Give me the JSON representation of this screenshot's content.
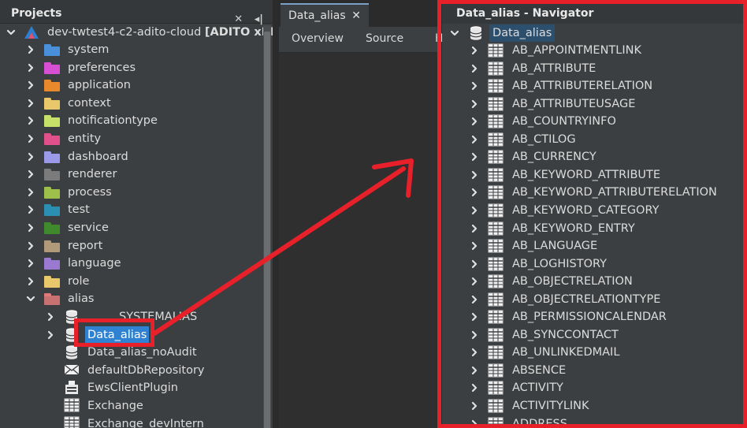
{
  "projects": {
    "title": "Projects",
    "close_glyph": "✕",
    "minimize_glyph": "◂|",
    "root_label": "dev-twtest4-c2-adito-cloud",
    "root_suffix": "[ADITO xRM]",
    "folders": [
      {
        "label": "system",
        "color": "#4a8fd9"
      },
      {
        "label": "preferences",
        "color": "#d94fd3"
      },
      {
        "label": "application",
        "color": "#e88a2c"
      },
      {
        "label": "context",
        "color": "#e8c86a"
      },
      {
        "label": "notificationtype",
        "color": "#c6e06a"
      },
      {
        "label": "entity",
        "color": "#e0508a"
      },
      {
        "label": "dashboard",
        "color": "#9a9ae8"
      },
      {
        "label": "renderer",
        "color": "#7b7b7b"
      },
      {
        "label": "process",
        "color": "#9dc04a"
      },
      {
        "label": "test",
        "color": "#2a8fb0"
      },
      {
        "label": "service",
        "color": "#3f8a2c"
      },
      {
        "label": "report",
        "color": "#b09a7a"
      },
      {
        "label": "language",
        "color": "#9a7ad0"
      },
      {
        "label": "role",
        "color": "#e8c86a"
      },
      {
        "label": "alias",
        "color": "#e07a7a"
      }
    ],
    "alias_children": [
      {
        "label": "SYSTEMALIAS",
        "icon": "database-icon"
      },
      {
        "label": "Data_alias",
        "icon": "database-icon"
      },
      {
        "label": "Data_alias_noAudit",
        "icon": "database-icon"
      },
      {
        "label": "defaultDbRepository",
        "icon": "envelope-icon"
      },
      {
        "label": "EwsClientPlugin",
        "icon": "plugin-icon"
      },
      {
        "label": "Exchange",
        "icon": "table-icon"
      },
      {
        "label": "Exchange_devIntern",
        "icon": "table-icon"
      }
    ]
  },
  "editor": {
    "tab_label": "Data_alias",
    "tab_close": "✕",
    "subtabs": [
      "Overview",
      "Source",
      "H"
    ]
  },
  "navigator": {
    "title": "Data_alias - Navigator",
    "root_label": "Data_alias",
    "tables": [
      "AB_APPOINTMENTLINK",
      "AB_ATTRIBUTE",
      "AB_ATTRIBUTERELATION",
      "AB_ATTRIBUTEUSAGE",
      "AB_COUNTRYINFO",
      "AB_CTILOG",
      "AB_CURRENCY",
      "AB_KEYWORD_ATTRIBUTE",
      "AB_KEYWORD_ATTRIBUTERELATION",
      "AB_KEYWORD_CATEGORY",
      "AB_KEYWORD_ENTRY",
      "AB_LANGUAGE",
      "AB_LOGHISTORY",
      "AB_OBJECTRELATION",
      "AB_OBJECTRELATIONTYPE",
      "AB_PERMISSIONCALENDAR",
      "AB_SYNCCONTACT",
      "AB_UNLINKEDMAIL",
      "ABSENCE",
      "ACTIVITY",
      "ACTIVITYLINK",
      "ADDRESS"
    ]
  },
  "colors": {
    "annotation": "#e8202a",
    "selection": "#2f82d2"
  }
}
